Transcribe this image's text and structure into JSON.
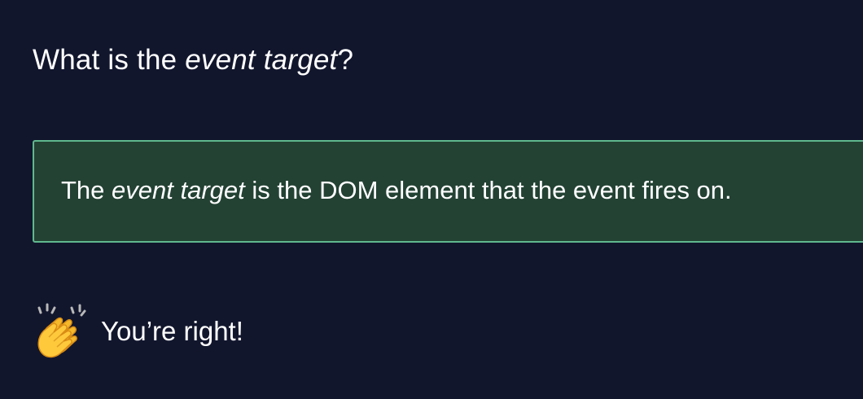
{
  "question": {
    "prefix": "What is the ",
    "emphasis": "event target",
    "suffix": "?"
  },
  "answer": {
    "prefix": "The ",
    "emphasis": "event target",
    "suffix": " is the DOM element that the event fires on."
  },
  "feedback": {
    "icon": "clapping-hands-icon",
    "text": "You’re right!"
  },
  "colors": {
    "background": "#12162d",
    "answer_background": "#234234",
    "answer_border": "#5fb88e",
    "text": "#ffffff"
  }
}
